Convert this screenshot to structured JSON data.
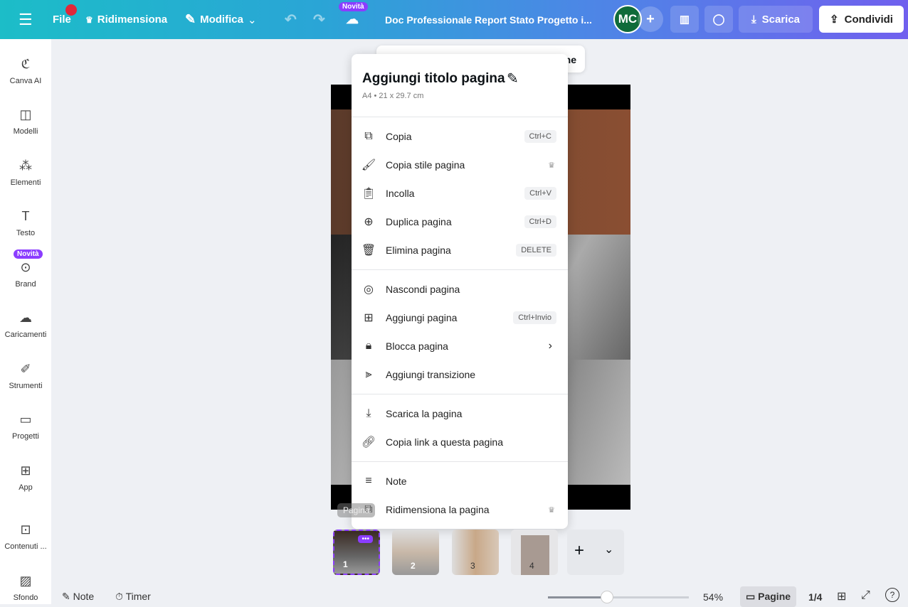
{
  "topbar": {
    "file": "File",
    "resize": "Ridimensiona",
    "edit": "Modifica",
    "new_badge": "Novità",
    "doc_title": "Doc Professionale Report Stato Progetto i...",
    "avatar": "MC",
    "download": "Scarica",
    "share": "Condividi"
  },
  "sidebar": [
    {
      "label": "Canva AI",
      "icon": "canva-ai-icon"
    },
    {
      "label": "Modelli",
      "icon": "templates-icon"
    },
    {
      "label": "Elementi",
      "icon": "elements-icon"
    },
    {
      "label": "Testo",
      "icon": "text-icon"
    },
    {
      "label": "Brand",
      "icon": "brand-icon",
      "badge": "Novità"
    },
    {
      "label": "Caricamenti",
      "icon": "upload-icon"
    },
    {
      "label": "Strumenti",
      "icon": "tools-icon"
    },
    {
      "label": "Progetti",
      "icon": "folder-icon"
    },
    {
      "label": "App",
      "icon": "apps-icon"
    },
    {
      "label": "Contenuti ...",
      "icon": "magic-media-icon"
    },
    {
      "label": "Sfondo",
      "icon": "background-icon"
    }
  ],
  "menu": {
    "title": "Aggiungi titolo pagina",
    "subtitle": "A4 • 21 x 29.7 cm",
    "items": [
      {
        "label": "Copia",
        "shortcut": "Ctrl+C"
      },
      {
        "label": "Copia stile pagina"
      },
      {
        "label": "Incolla",
        "shortcut": "Ctrl+V"
      },
      {
        "label": "Duplica pagina",
        "shortcut": "Ctrl+D"
      },
      {
        "label": "Elimina pagina",
        "shortcut": "DELETE"
      },
      {
        "label": "Nascondi pagina"
      },
      {
        "label": "Aggiungi pagina",
        "shortcut": "Ctrl+Invio"
      },
      {
        "label": "Blocca pagina"
      },
      {
        "label": "Aggiungi transizione"
      },
      {
        "label": "Scarica la pagina"
      },
      {
        "label": "Copia link a questa pagina"
      },
      {
        "label": "Note"
      },
      {
        "label": "Ridimensiona la pagina"
      }
    ]
  },
  "toolbar_partial": "ne",
  "tooltip": "Pagina",
  "thumbnails": [
    "1",
    "2",
    "3",
    "4"
  ],
  "bottom": {
    "notes": "Note",
    "timer": "Timer",
    "zoom": "54%",
    "zoom_value": 0.54,
    "pages": "Pagine",
    "page_count": "1/4"
  },
  "colors": {
    "accent": "#8b3dff"
  }
}
